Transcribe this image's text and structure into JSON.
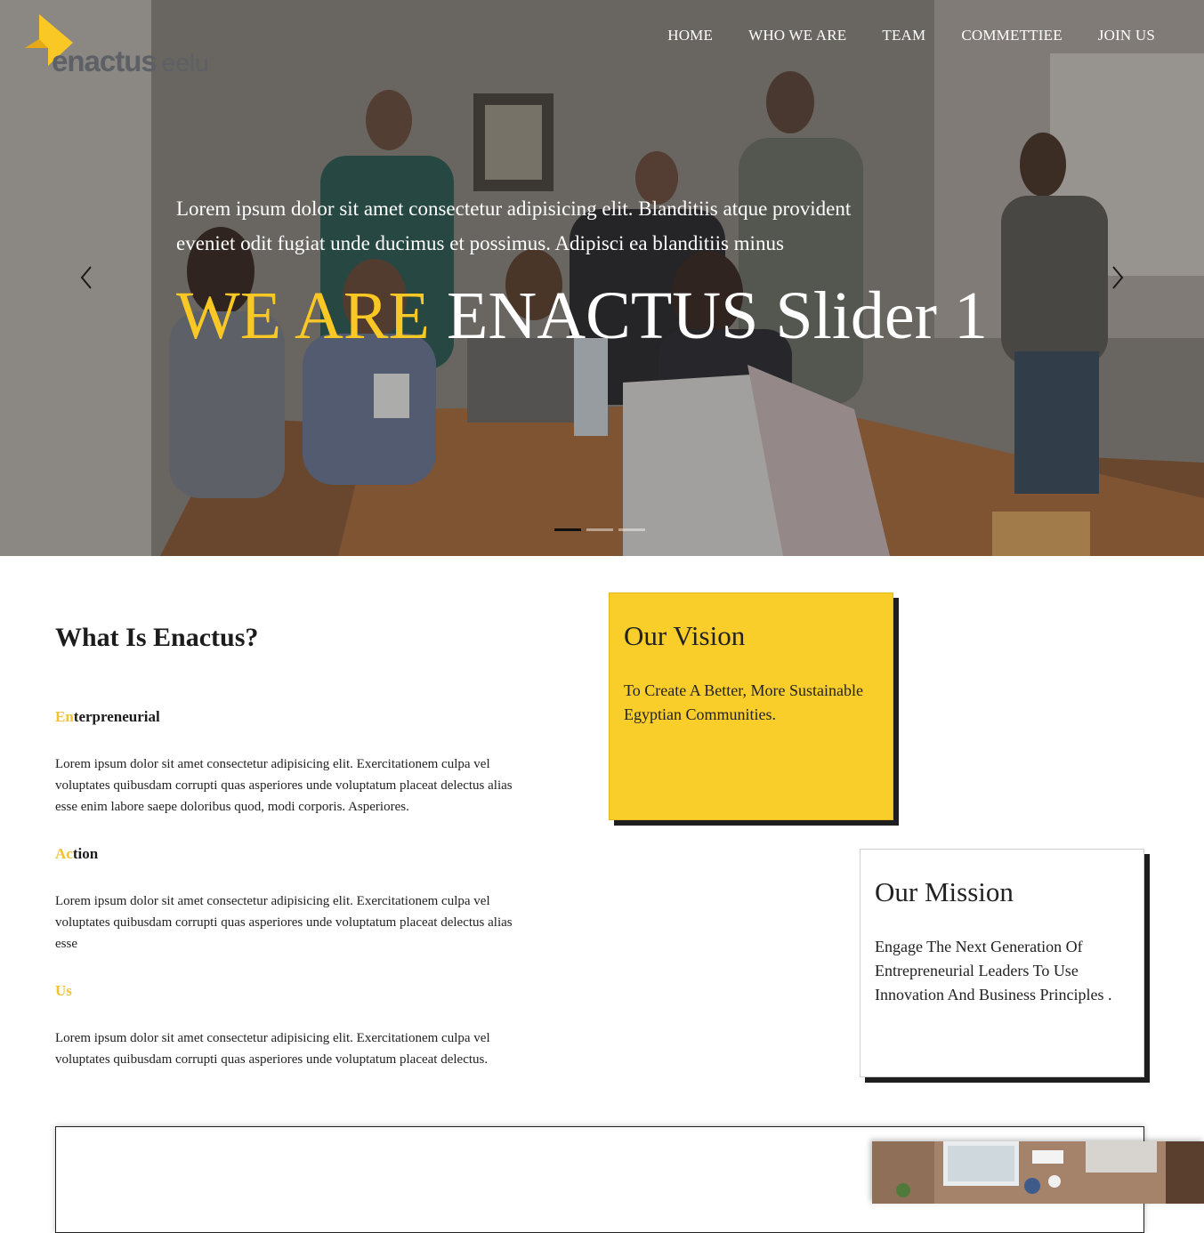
{
  "brand": {
    "name": "enactus",
    "suffix": "eelu"
  },
  "nav": {
    "items": [
      {
        "label": "HOME"
      },
      {
        "label": "WHO WE ARE"
      },
      {
        "label": "TEAM"
      },
      {
        "label": "COMMETTIEE"
      },
      {
        "label": "JOIN US"
      }
    ]
  },
  "hero": {
    "paragraph": "Lorem ipsum dolor sit amet consectetur adipisicing elit. Blanditiis atque provident eveniet odit fugiat unde ducimus et possimus. Adipisci ea blanditiis minus",
    "title_highlight": "WE ARE",
    "title_rest": "ENACTUS Slider 1",
    "slide_count": 3,
    "active_slide": 1
  },
  "about": {
    "heading": "What Is Enactus?",
    "sections": [
      {
        "highlight": "En",
        "rest": "terpreneurial",
        "text": "Lorem ipsum dolor sit amet consectetur adipisicing elit. Exercitationem culpa vel voluptates quibusdam corrupti quas asperiores unde voluptatum placeat delectus alias esse enim labore saepe doloribus quod, modi corporis. Asperiores."
      },
      {
        "highlight": "Ac",
        "rest": "tion",
        "text": "Lorem ipsum dolor sit amet consectetur adipisicing elit. Exercitationem culpa vel voluptates quibusdam corrupti quas asperiores unde voluptatum placeat delectus alias esse"
      },
      {
        "highlight": "Us",
        "rest": "",
        "text": "Lorem ipsum dolor sit amet consectetur adipisicing elit. Exercitationem culpa vel voluptates quibusdam corrupti quas asperiores unde voluptatum placeat delectus."
      }
    ]
  },
  "vision": {
    "title": "Our Vision",
    "text": "To Create A Better, More Sustainable Egyptian Communities."
  },
  "mission": {
    "title": "Our Mission",
    "text": "Engage The Next Generation Of Entrepreneurial Leaders To Use Innovation And Business Principles ."
  },
  "colors": {
    "accent": "#f9c825",
    "card_yellow": "#f9cd2a",
    "shadow": "#1e1e1e"
  },
  "icons": {
    "prev": "chevron-left-icon",
    "next": "chevron-right-icon"
  }
}
